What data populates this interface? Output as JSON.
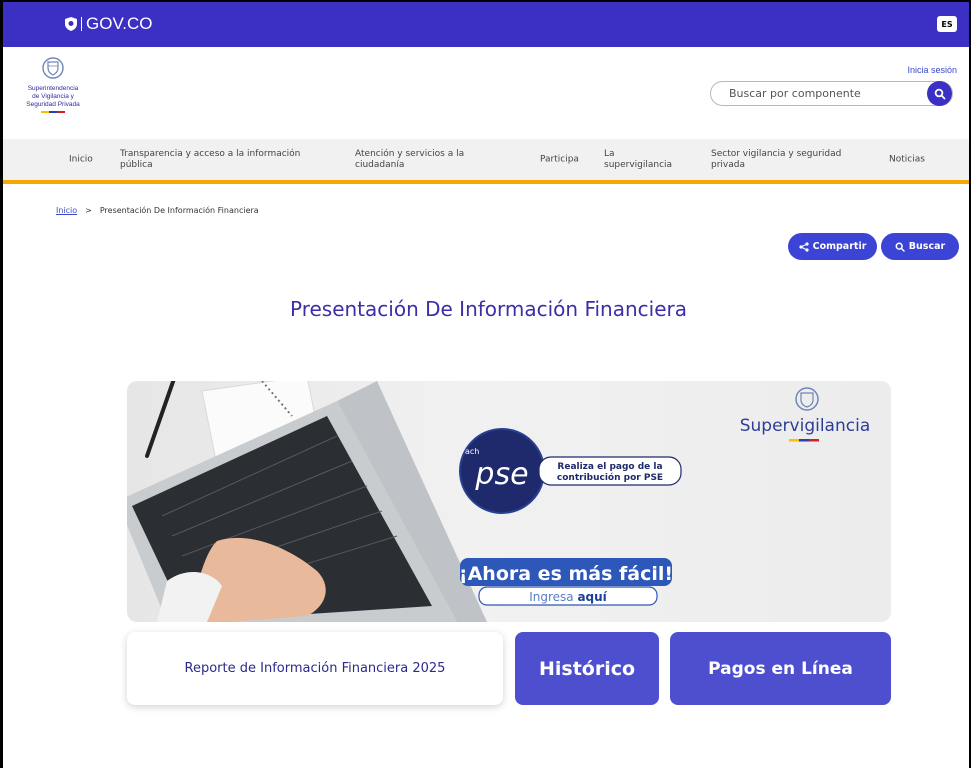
{
  "govbar": {
    "logo_text": "GOV.CO",
    "lang_label": "ES"
  },
  "entity": {
    "name_lines": [
      "Superintendencia",
      "de Vigilancia y",
      "Seguridad Privada"
    ]
  },
  "header": {
    "login_label": "Inicia sesión",
    "search_placeholder": "Buscar por componente"
  },
  "nav": {
    "items": [
      {
        "label": "Inicio"
      },
      {
        "label": "Transparencia y acceso a la información pública"
      },
      {
        "label": "Atención y servicios a la ciudadanía"
      },
      {
        "label": "Participa"
      },
      {
        "label": "La supervigilancia"
      },
      {
        "label": "Sector vigilancia y seguridad privada"
      },
      {
        "label": "Noticias"
      }
    ]
  },
  "breadcrumb": {
    "home": "Inicio",
    "separator": ">",
    "current": "Presentación De Información Financiera"
  },
  "actions": {
    "share_label": "Compartir",
    "search_label": "Buscar"
  },
  "page_title": "Presentación De Información Financiera",
  "banner": {
    "pse_label": "pse",
    "pse_small": "ach",
    "pse_message_1": "Realiza el pago de la",
    "pse_message_2": "contribución por PSE",
    "brand": "Supervigilancia",
    "headline": "¡Ahora es más fácil!",
    "cta_prefix": "Ingresa",
    "cta_bold": "aquí"
  },
  "cards": {
    "report_label": "Reporte de Información Financiera 2025",
    "history_label": "Histórico",
    "payments_label": "Pagos en Línea"
  },
  "colors": {
    "primary": "#3c2fc3",
    "accent": "#f5a800",
    "button": "#4e4fcf",
    "title": "#3b2fa8"
  }
}
